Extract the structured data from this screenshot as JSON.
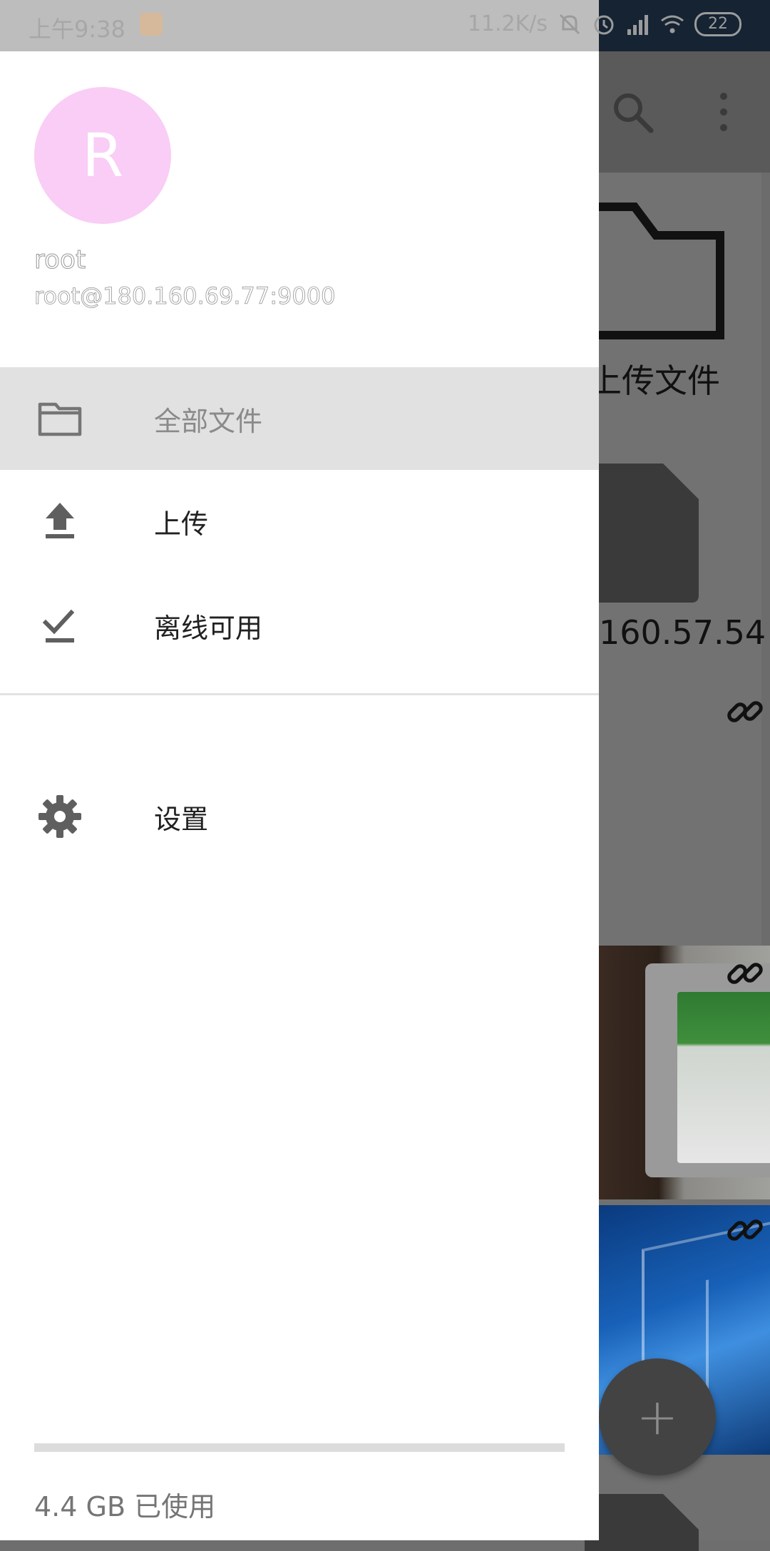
{
  "status_bar": {
    "time": "上午9:38",
    "network_speed": "11.2K/s",
    "battery": "22"
  },
  "drawer": {
    "avatar_letter": "R",
    "user_name": "root",
    "account": "root@180.160.69.77:9000",
    "menu": [
      {
        "label": "全部文件",
        "icon": "folder-icon",
        "selected": true
      },
      {
        "label": "上传",
        "icon": "upload-icon",
        "selected": false
      },
      {
        "label": "离线可用",
        "icon": "offline-check-icon",
        "selected": false
      },
      {
        "label": "设置",
        "icon": "gear-icon",
        "selected": false
      }
    ],
    "storage_used": "4.4 GB 已使用",
    "storage_fraction": 0.0
  },
  "background": {
    "upload_folder_label": "上传文件",
    "server_item_label": "160.57.54",
    "fab_label": "+"
  },
  "colors": {
    "avatar": "#f9cdf5",
    "selected_row": "#e1e1e1",
    "icon": "#757575"
  }
}
